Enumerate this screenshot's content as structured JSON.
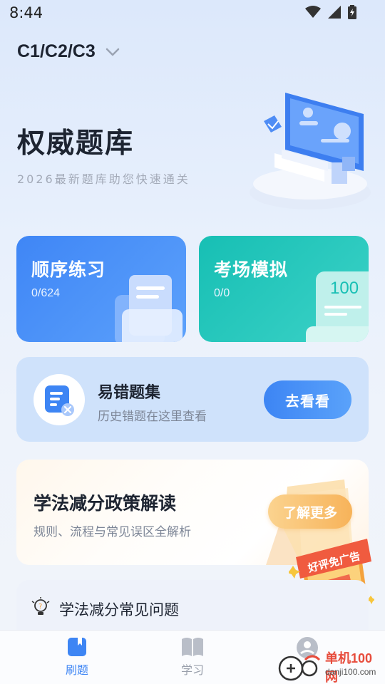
{
  "status_bar": {
    "time": "8:44",
    "icons": [
      "wifi-icon",
      "signal-icon",
      "battery-charging-icon"
    ]
  },
  "license": {
    "label": "C1/C2/C3",
    "icon": "chevron-down-icon"
  },
  "hero": {
    "title": "权威题库",
    "subtitle": "2026最新题库助您快速通关"
  },
  "practice_cards": [
    {
      "title": "顺序练习",
      "progress": "0/624",
      "color": "#3f86f6"
    },
    {
      "title": "考场模拟",
      "progress": "0/0",
      "color": "#17bfb4",
      "badge_number": "100"
    }
  ],
  "mistakes": {
    "title": "易错题集",
    "description": "历史错题在这里查看",
    "button_label": "去看看"
  },
  "policy": {
    "title": "学法减分政策解读",
    "description": "规则、流程与常见误区全解析",
    "button_label": "了解更多"
  },
  "ad_badge": {
    "label": "好评免广告"
  },
  "faq": {
    "label": "学法减分常见问题"
  },
  "bottom_nav": {
    "items": [
      {
        "label": "刷题",
        "icon": "book-icon",
        "active": true
      },
      {
        "label": "学习",
        "icon": "open-book-icon",
        "active": false
      },
      {
        "label": "",
        "icon": "profile-icon",
        "active": false
      }
    ]
  },
  "watermark": {
    "main": "单机100网",
    "sub": "danji100.com"
  },
  "colors": {
    "accent_blue": "#3f86f6",
    "accent_teal": "#17bfb4",
    "accent_orange": "#f7b35a"
  }
}
